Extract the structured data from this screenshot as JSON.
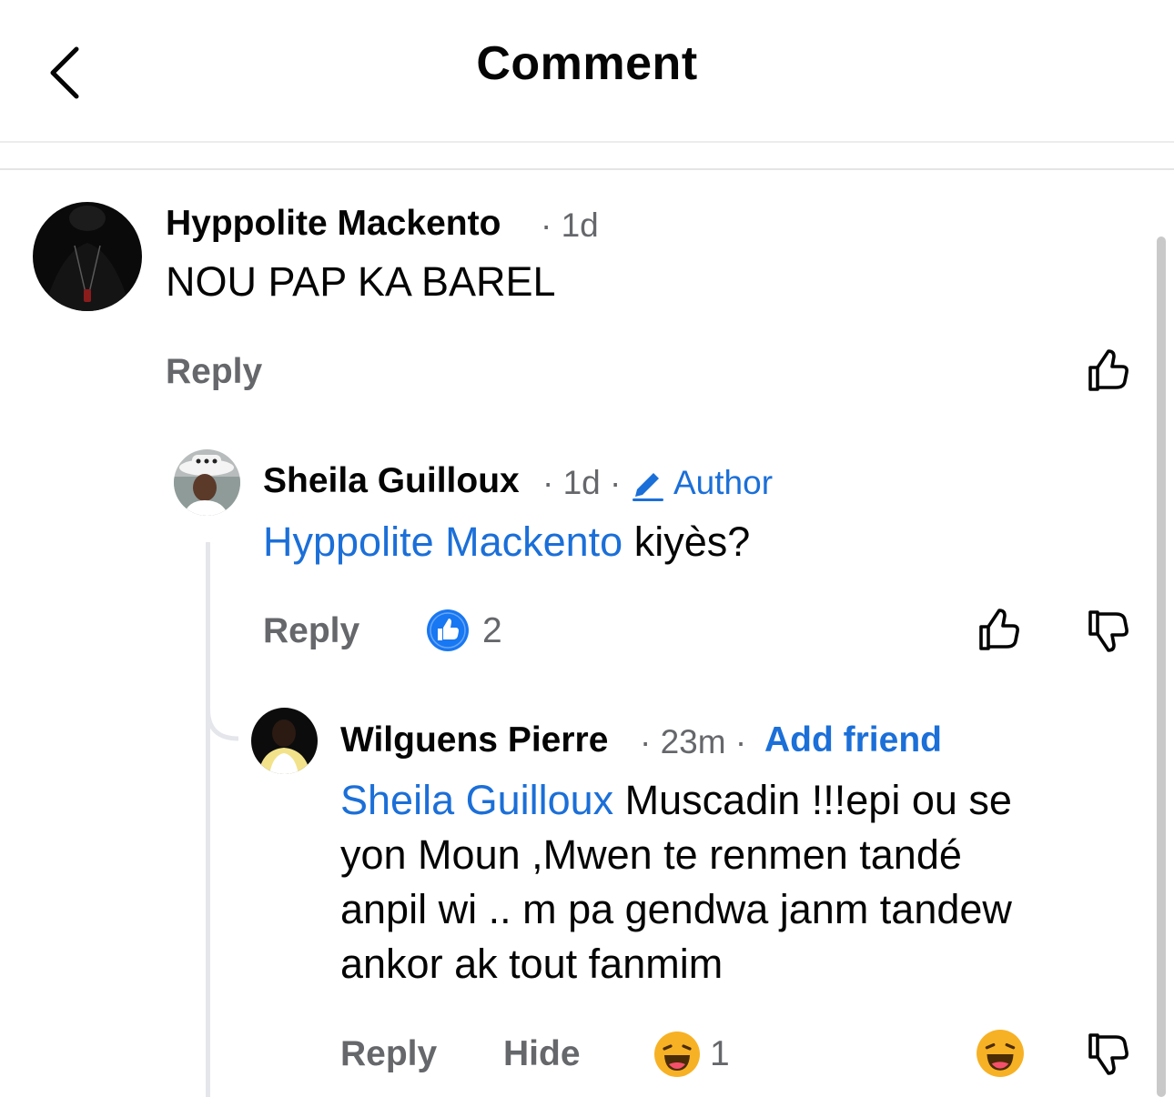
{
  "header": {
    "title": "Comment"
  },
  "comment1": {
    "author": "Hyppolite Mackento",
    "time": "1d",
    "text": "NOU PAP KA BAREL",
    "reply_label": "Reply"
  },
  "comment2": {
    "author": "Sheila Guilloux",
    "time": "1d",
    "badge": "Author",
    "mention": "Hyppolite Mackento",
    "text": " kiyès?",
    "reply_label": "Reply",
    "reaction_count": "2"
  },
  "comment3": {
    "author": "Wilguens Pierre",
    "time": "23m",
    "add_friend": "Add friend",
    "mention": "Sheila Guilloux",
    "text_lines": [
      " Muscadin !!!epi ou se",
      "yon Moun ,Mwen te renmen tandé",
      "anpil wi .. m pa gendwa janm tandew",
      "ankor ak tout fanmim"
    ],
    "reply_label": "Reply",
    "hide_label": "Hide",
    "reaction_count": "1"
  },
  "separator": "·",
  "colors": {
    "link": "#1b6fd8",
    "muted": "#65676b",
    "reaction_like": "#1877f2",
    "reaction_haha": "#f7b125"
  },
  "icons": [
    "back-chevron-icon",
    "like-icon",
    "dislike-icon",
    "like-reaction-icon",
    "pencil-icon",
    "haha-reaction-icon"
  ]
}
